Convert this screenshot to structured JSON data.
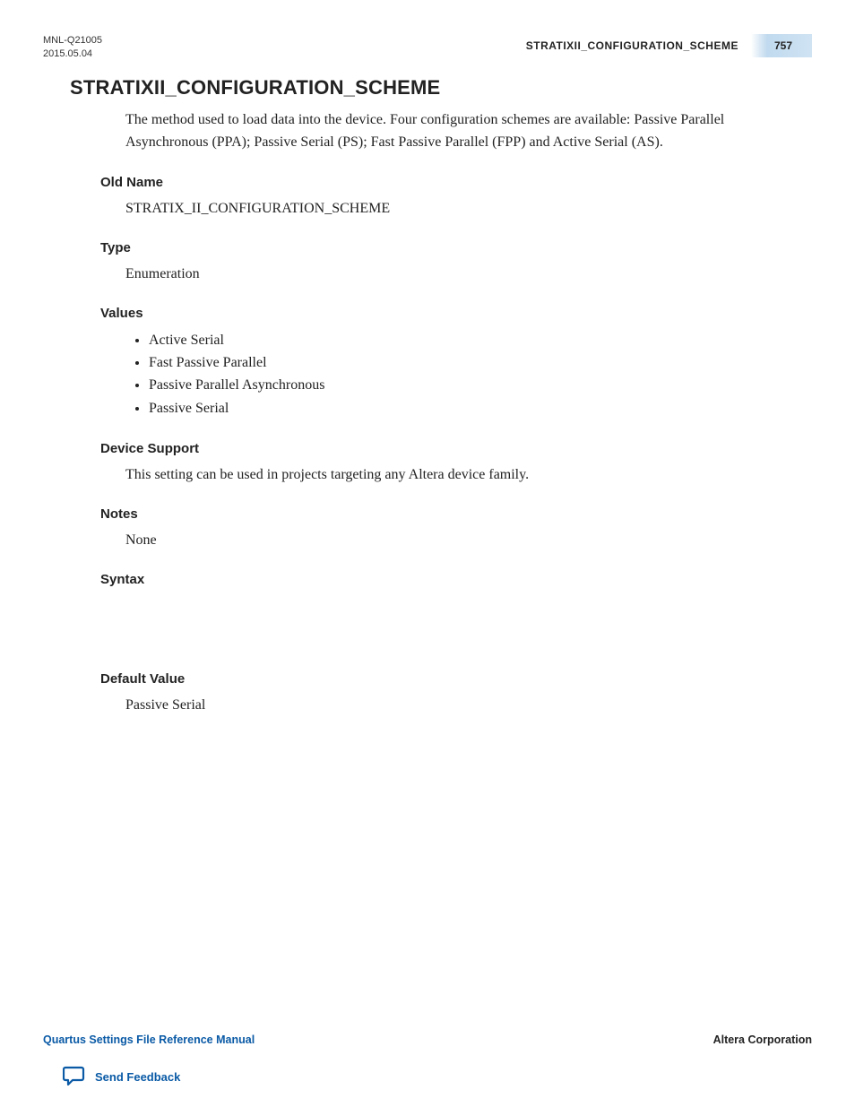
{
  "header": {
    "doc_code": "MNL-Q21005",
    "doc_date": "2015.05.04",
    "running_title": "STRATIXII_CONFIGURATION_SCHEME",
    "page_number": "757"
  },
  "main": {
    "title": "STRATIXII_CONFIGURATION_SCHEME",
    "description": "The method used to load data into the device. Four configuration schemes are available: Passive Parallel Asynchronous (PPA); Passive Serial (PS); Fast Passive Parallel (FPP) and Active Serial (AS).",
    "sections": {
      "old_name": {
        "heading": "Old Name",
        "body": "STRATIX_II_CONFIGURATION_SCHEME"
      },
      "type": {
        "heading": "Type",
        "body": "Enumeration"
      },
      "values": {
        "heading": "Values",
        "items": [
          "Active Serial",
          "Fast Passive Parallel",
          "Passive Parallel Asynchronous",
          "Passive Serial"
        ]
      },
      "device_support": {
        "heading": "Device Support",
        "body": "This setting can be used in projects targeting any Altera device family."
      },
      "notes": {
        "heading": "Notes",
        "body": "None"
      },
      "syntax": {
        "heading": "Syntax",
        "body": ""
      },
      "default_value": {
        "heading": "Default Value",
        "body": "Passive Serial"
      }
    }
  },
  "footer": {
    "manual_title": "Quartus Settings File Reference Manual",
    "company": "Altera Corporation",
    "feedback_label": "Send Feedback"
  }
}
